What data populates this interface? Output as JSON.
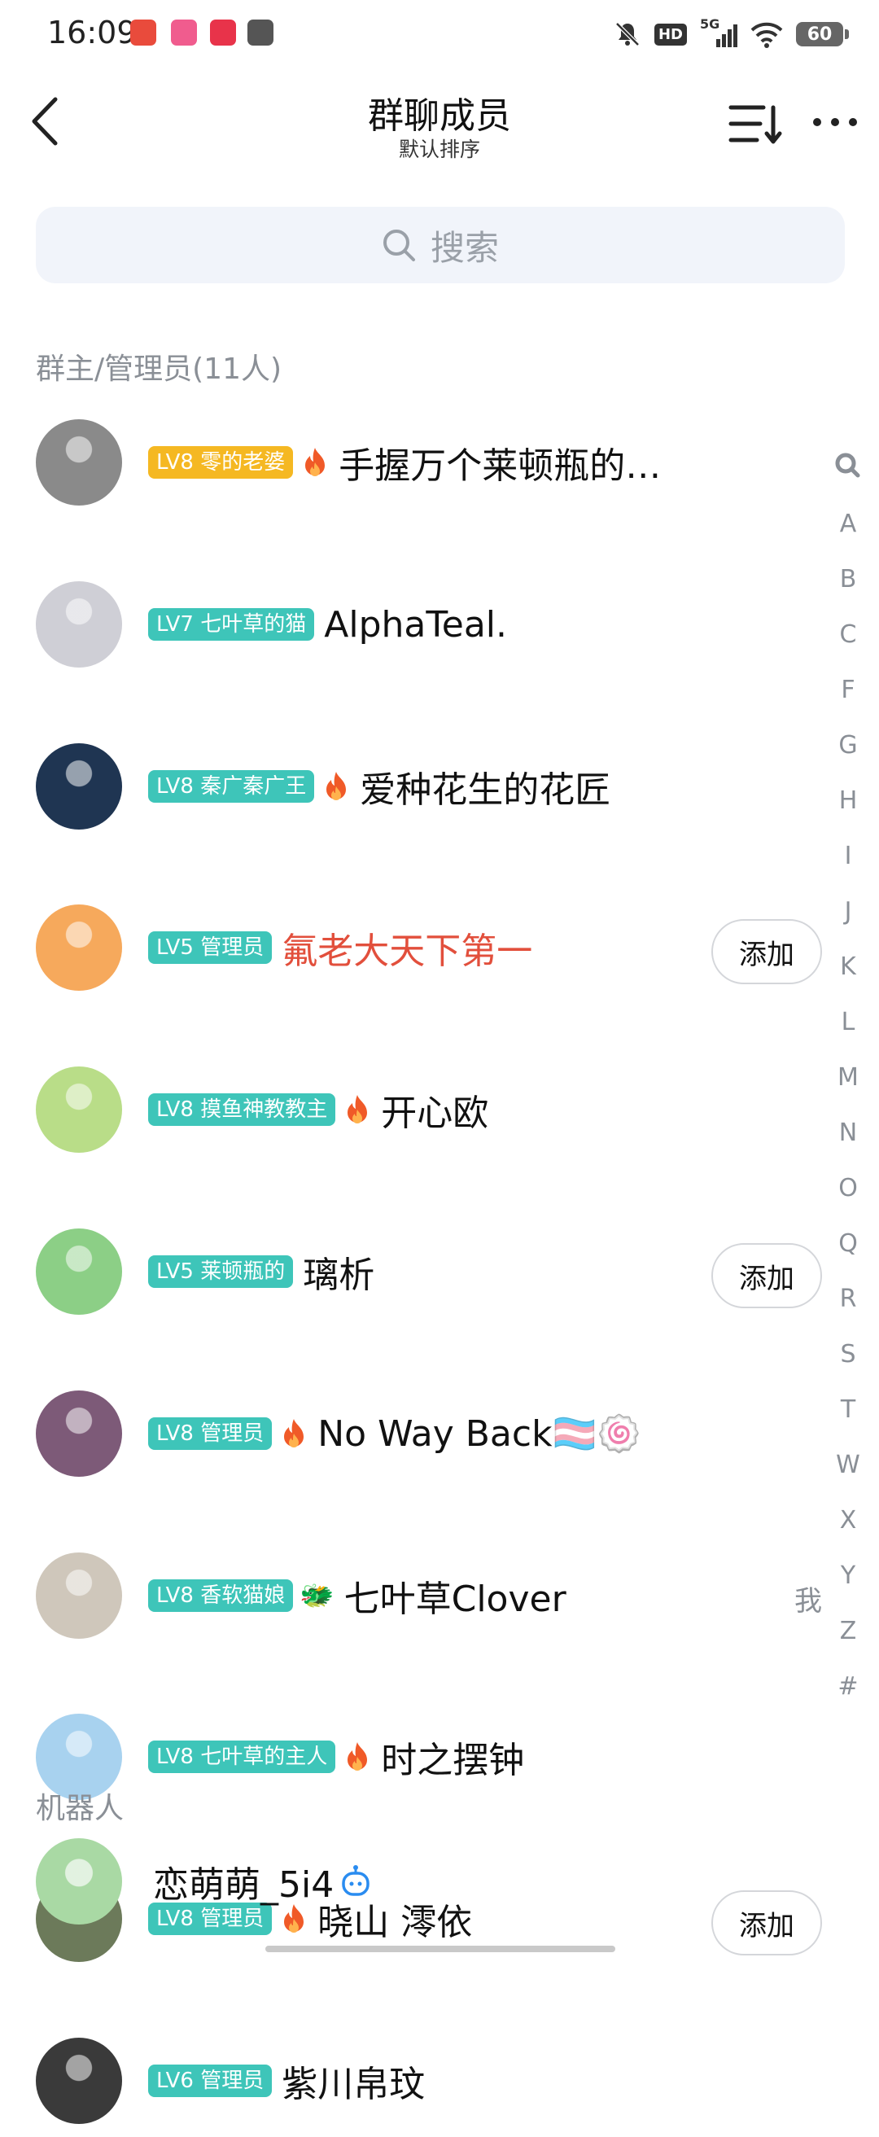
{
  "status_bar": {
    "time": "16:09",
    "network": "5G",
    "hd": "HD",
    "battery": "60"
  },
  "header": {
    "title": "群聊成员",
    "subtitle": "默认排序"
  },
  "search": {
    "placeholder": "搜索"
  },
  "sections": {
    "admins": "群主/管理员(11人)",
    "bots": "机器人"
  },
  "members": [
    {
      "level": "LV8",
      "title": "零的老婆",
      "badge_style": "gold",
      "flame": true,
      "name": "手握万个莱顿瓶的…",
      "avatar_color": "#8a8a8a"
    },
    {
      "level": "LV7",
      "title": "七叶草的猫",
      "badge_style": "teal",
      "flame": false,
      "name": "AlphaTeal.",
      "avatar_color": "#cfcfd6"
    },
    {
      "level": "LV8",
      "title": "秦广秦广王",
      "badge_style": "teal",
      "flame": true,
      "name": "爱种花生的花匠",
      "avatar_color": "#1f3552"
    },
    {
      "level": "LV5",
      "title": "管理员",
      "badge_style": "teal",
      "flame": false,
      "name": "氟老大天下第一",
      "name_color": "red",
      "add": "添加",
      "avatar_color": "#f6a95c"
    },
    {
      "level": "LV8",
      "title": "摸鱼神教教主",
      "badge_style": "teal",
      "flame": true,
      "name": "开心欧",
      "avatar_color": "#b9dd88"
    },
    {
      "level": "LV5",
      "title": "莱顿瓶的",
      "badge_style": "teal",
      "flame": false,
      "name": "璃析",
      "add": "添加",
      "avatar_color": "#8ccf86"
    },
    {
      "level": "LV8",
      "title": "管理员",
      "badge_style": "teal",
      "flame": true,
      "name": "No Way Back🏳️‍⚧️🍥",
      "avatar_color": "#7d5a78"
    },
    {
      "level": "LV8",
      "title": "香软猫娘",
      "badge_style": "teal",
      "flame": false,
      "extra_icon": "🐲",
      "name": "七叶草Clover",
      "me": "我",
      "avatar_color": "#cfc7bb"
    },
    {
      "level": "LV8",
      "title": "七叶草的主人",
      "badge_style": "teal",
      "flame": true,
      "name": "时之摆钟",
      "avatar_color": "#a8d2ef"
    },
    {
      "level": "LV8",
      "title": "管理员",
      "badge_style": "teal",
      "flame": true,
      "name": "晓山 澪依",
      "add": "添加",
      "avatar_color": "#6c7a5a"
    },
    {
      "level": "LV6",
      "title": "管理员",
      "badge_style": "teal",
      "flame": false,
      "name": "紫川帛玟",
      "avatar_color": "#3a3a3a"
    }
  ],
  "bots": [
    {
      "name": "恋萌萌_5i4",
      "avatar_color": "#a9d9a4"
    }
  ],
  "index_letters": [
    "A",
    "B",
    "C",
    "F",
    "G",
    "H",
    "I",
    "J",
    "K",
    "L",
    "M",
    "N",
    "O",
    "Q",
    "R",
    "S",
    "T",
    "W",
    "X",
    "Y",
    "Z",
    "#"
  ],
  "colors": {
    "teal_badge": "#3ec5b9",
    "gold_badge": "#f5b822",
    "red_name": "#e24f3c",
    "flame": "#f05a28",
    "search_bg": "#f1f4fa"
  }
}
